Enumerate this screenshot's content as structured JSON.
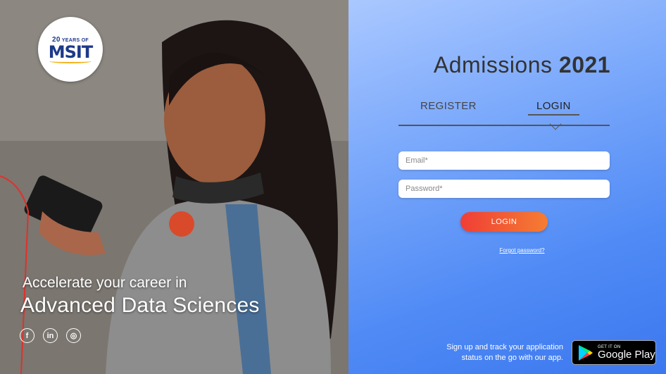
{
  "brand": {
    "logo_years_num": "20",
    "logo_years_text": "YEARS OF",
    "logo_name": "MSIT"
  },
  "hero": {
    "tagline_line1": "Accelerate your career in",
    "tagline_line2": "Advanced Data Sciences"
  },
  "social": [
    "f",
    "in",
    "◎"
  ],
  "auth": {
    "title_main": "Admissions",
    "title_year": "2021",
    "tab_register": "REGISTER",
    "tab_login": "LOGIN",
    "email_placeholder": "Email*",
    "password_placeholder": "Password*",
    "login_button": "LOGIN",
    "forgot_link": "Forgot password?"
  },
  "app_promo": {
    "line1": "Sign up and track your application",
    "line2": "status on the go with our app.",
    "badge_small": "GET IT ON",
    "badge_big": "Google Play"
  },
  "colors": {
    "accent_start": "#ef3e36",
    "accent_end": "#f57d32",
    "panel_blue": "#4f8af5"
  }
}
